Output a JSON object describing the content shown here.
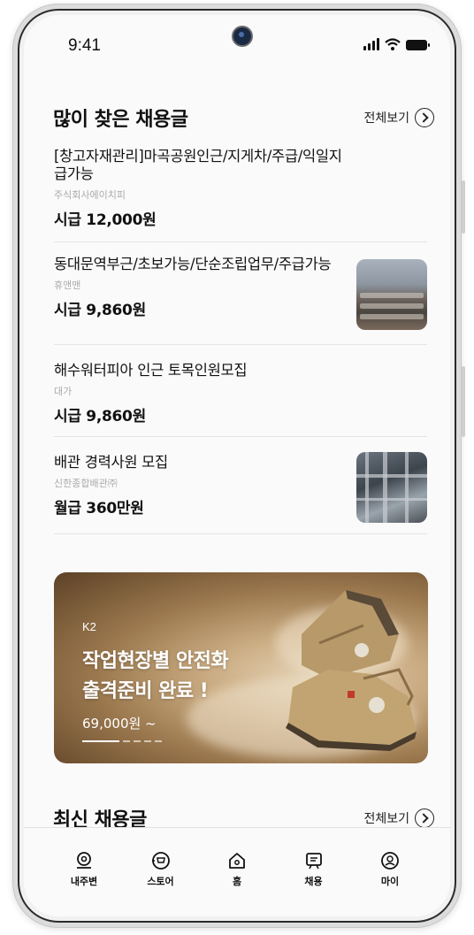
{
  "status_bar": {
    "time": "9:41"
  },
  "popular": {
    "title": "많이 찾은 채용글",
    "see_all": "전체보기",
    "jobs": [
      {
        "title": "[창고자재관리]마곡공원인근/지게차/주급/익일지급가능",
        "company": "주식회사에이치피",
        "pay": "시급 12,000원"
      },
      {
        "title": "동대문역부근/초보가능/단순조립업무/주급가능",
        "company": "휴앤맨",
        "pay": "시급 9,860원"
      },
      {
        "title": "해수워터피아 인근 토목인원모집",
        "company": "대가",
        "pay": "시급 9,860원"
      },
      {
        "title": "배관 경력사원 모집",
        "company": "신한종합배관㈜",
        "pay": "월급 360만원"
      }
    ]
  },
  "banner": {
    "brand": "K2",
    "title_line1": "작업현장별 안전화",
    "title_line2": "출격준비 완료 !",
    "price": "69,000원 ~"
  },
  "latest": {
    "title": "최신 채용글",
    "see_all": "전체보기"
  },
  "bottom_nav": [
    {
      "label": "내주변",
      "icon": "location-pin-icon"
    },
    {
      "label": "스토어",
      "icon": "cart-icon"
    },
    {
      "label": "홈",
      "icon": "home-icon"
    },
    {
      "label": "채용",
      "icon": "job-board-icon"
    },
    {
      "label": "마이",
      "icon": "profile-icon"
    }
  ]
}
